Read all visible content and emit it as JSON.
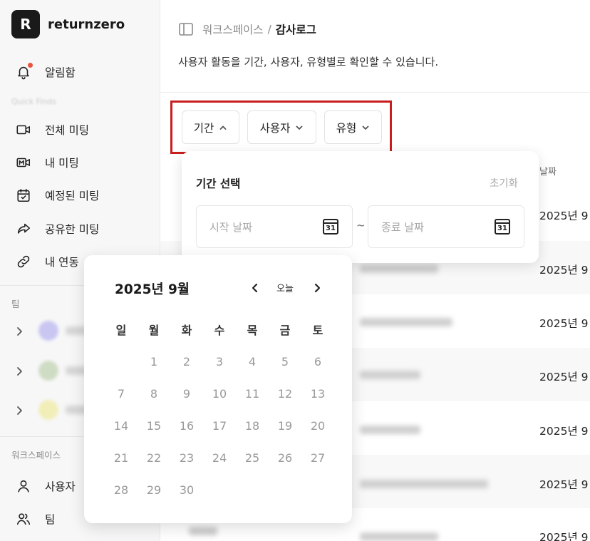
{
  "brand": {
    "logo_letter": "R",
    "name": "returnzero"
  },
  "sidebar": {
    "notifications": {
      "label": "알림함",
      "icon": "bell-icon",
      "badge_color": "#e8543f"
    },
    "faded_section": "Quick Finds",
    "items": [
      {
        "label": "전체 미팅",
        "icon": "video-icon"
      },
      {
        "label": "내 미팅",
        "icon": "mic-video-icon"
      },
      {
        "label": "예정된 미팅",
        "icon": "calendar-check-icon"
      },
      {
        "label": "공유한 미팅",
        "icon": "share-arrow-icon"
      },
      {
        "label": "내 연동",
        "icon": "link-icon"
      }
    ],
    "team_section": "팀",
    "workspace_section": "워크스페이스",
    "workspace_items": [
      {
        "label": "사용자",
        "icon": "user-icon"
      },
      {
        "label": "팀",
        "icon": "users-icon"
      }
    ]
  },
  "header": {
    "breadcrumb_parent": "워크스페이스",
    "breadcrumb_sep": "/",
    "breadcrumb_current": "감사로그",
    "description": "사용자 활동을 기간, 사용자, 유형별로 확인할 수 있습니다."
  },
  "filters": [
    {
      "label": "기간",
      "state": "open"
    },
    {
      "label": "사용자",
      "state": "closed"
    },
    {
      "label": "유형",
      "state": "closed"
    }
  ],
  "table": {
    "date_header": "날짜",
    "dates": [
      "2025년 9",
      "2025년 9",
      "2025년 9",
      "2025년 9",
      "2025년 9",
      "2025년 9",
      "2025년 9"
    ]
  },
  "period_popover": {
    "title": "기간 선택",
    "reset": "초기화",
    "start_placeholder": "시작 날짜",
    "end_placeholder": "종료 날짜",
    "separator": "~",
    "calendar_icon_text": "31"
  },
  "calendar": {
    "title": "2025년 9월",
    "today": "오늘",
    "weekdays": [
      "일",
      "월",
      "화",
      "수",
      "목",
      "금",
      "토"
    ],
    "weeks": [
      [
        "",
        "1",
        "2",
        "3",
        "4",
        "5",
        "6"
      ],
      [
        "7",
        "8",
        "9",
        "10",
        "11",
        "12",
        "13"
      ],
      [
        "14",
        "15",
        "16",
        "17",
        "18",
        "19",
        "20"
      ],
      [
        "21",
        "22",
        "23",
        "24",
        "25",
        "26",
        "27"
      ],
      [
        "28",
        "29",
        "30",
        "",
        "",
        "",
        ""
      ]
    ]
  }
}
